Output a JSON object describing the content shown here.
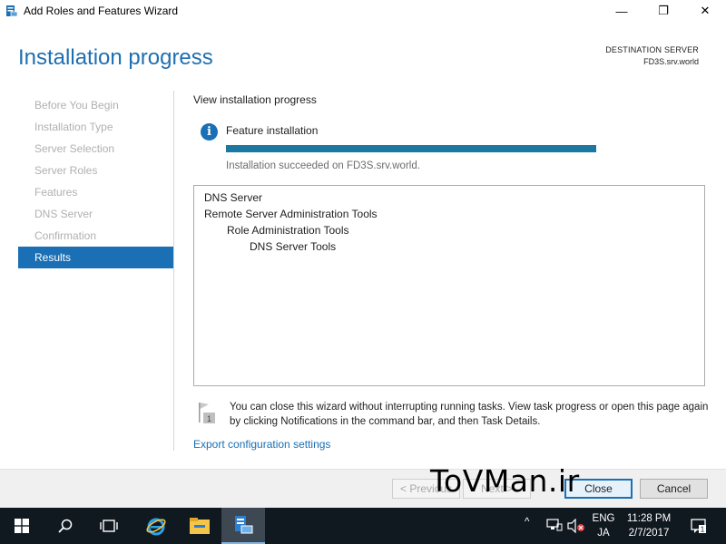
{
  "window": {
    "title": "Add Roles and Features Wizard",
    "controls": {
      "minimize": "—",
      "maximize": "❐",
      "close": "✕"
    }
  },
  "header": {
    "title": "Installation progress",
    "destination_label": "DESTINATION SERVER",
    "destination_value": "FD3S.srv.world"
  },
  "nav": {
    "items": [
      {
        "label": "Before You Begin",
        "active": false
      },
      {
        "label": "Installation Type",
        "active": false
      },
      {
        "label": "Server Selection",
        "active": false
      },
      {
        "label": "Server Roles",
        "active": false
      },
      {
        "label": "Features",
        "active": false
      },
      {
        "label": "DNS Server",
        "active": false
      },
      {
        "label": "Confirmation",
        "active": false
      },
      {
        "label": "Results",
        "active": true
      }
    ]
  },
  "main": {
    "section_title": "View installation progress",
    "feature_label": "Feature installation",
    "progress_percent": 100,
    "status_text": "Installation succeeded on FD3S.srv.world.",
    "results": [
      {
        "text": "DNS Server",
        "level": 0
      },
      {
        "text": "Remote Server Administration Tools",
        "level": 0
      },
      {
        "text": "Role Administration Tools",
        "level": 1
      },
      {
        "text": "DNS Server Tools",
        "level": 2
      }
    ],
    "note_text": "You can close this wizard without interrupting running tasks. View task progress or open this page again by clicking Notifications in the command bar, and then Task Details.",
    "note_badge": "1",
    "export_link": "Export configuration settings"
  },
  "footer": {
    "previous_label": "< Previous",
    "next_label": "Next >",
    "close_label": "Close",
    "cancel_label": "Cancel",
    "watermark": "ToVMan.ir"
  },
  "taskbar": {
    "items": [
      "start-icon",
      "search-icon",
      "task-view-icon",
      "internet-explorer-icon",
      "file-explorer-icon",
      "server-manager-icon"
    ],
    "lang_top": "ENG",
    "lang_bottom": "JA",
    "time": "11:28 PM",
    "date": "2/7/2017",
    "notification_count": "1"
  },
  "colors": {
    "accent": "#1a6fb5",
    "progress": "#1b78a0",
    "taskbar": "#101820"
  }
}
